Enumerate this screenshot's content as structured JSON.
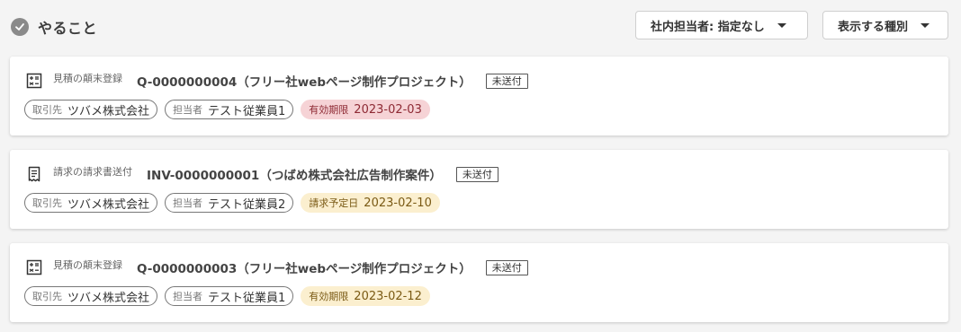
{
  "header": {
    "title": "やること",
    "assignee_filter_label": "社内担当者: 指定なし",
    "kind_filter_label": "表示する種別"
  },
  "tasks": [
    {
      "icon": "calculator-icon",
      "type_label": "見積の顛末登録",
      "doc_title": "Q-0000000004（フリー社webページ制作プロジェクト）",
      "status": "未送付",
      "client_key": "取引先",
      "client": "ツバメ株式会社",
      "assignee_key": "担当者",
      "assignee": "テスト従業員1",
      "date_key": "有効期限",
      "date": "2023-02-03",
      "date_color": "#f6d3d6"
    },
    {
      "icon": "receipt-icon",
      "type_label": "請求の請求書送付",
      "doc_title": "INV-0000000001（つばめ株式会社広告制作案件）",
      "status": "未送付",
      "client_key": "取引先",
      "client": "ツバメ株式会社",
      "assignee_key": "担当者",
      "assignee": "テスト従業員2",
      "date_key": "請求予定日",
      "date": "2023-02-10",
      "date_color": "#fbefcf"
    },
    {
      "icon": "calculator-icon",
      "type_label": "見積の顛末登録",
      "doc_title": "Q-0000000003（フリー社webページ制作プロジェクト）",
      "status": "未送付",
      "client_key": "取引先",
      "client": "ツバメ株式会社",
      "assignee_key": "担当者",
      "assignee": "テスト従業員1",
      "date_key": "有効期限",
      "date": "2023-02-12",
      "date_color": "#fbefcf"
    }
  ]
}
